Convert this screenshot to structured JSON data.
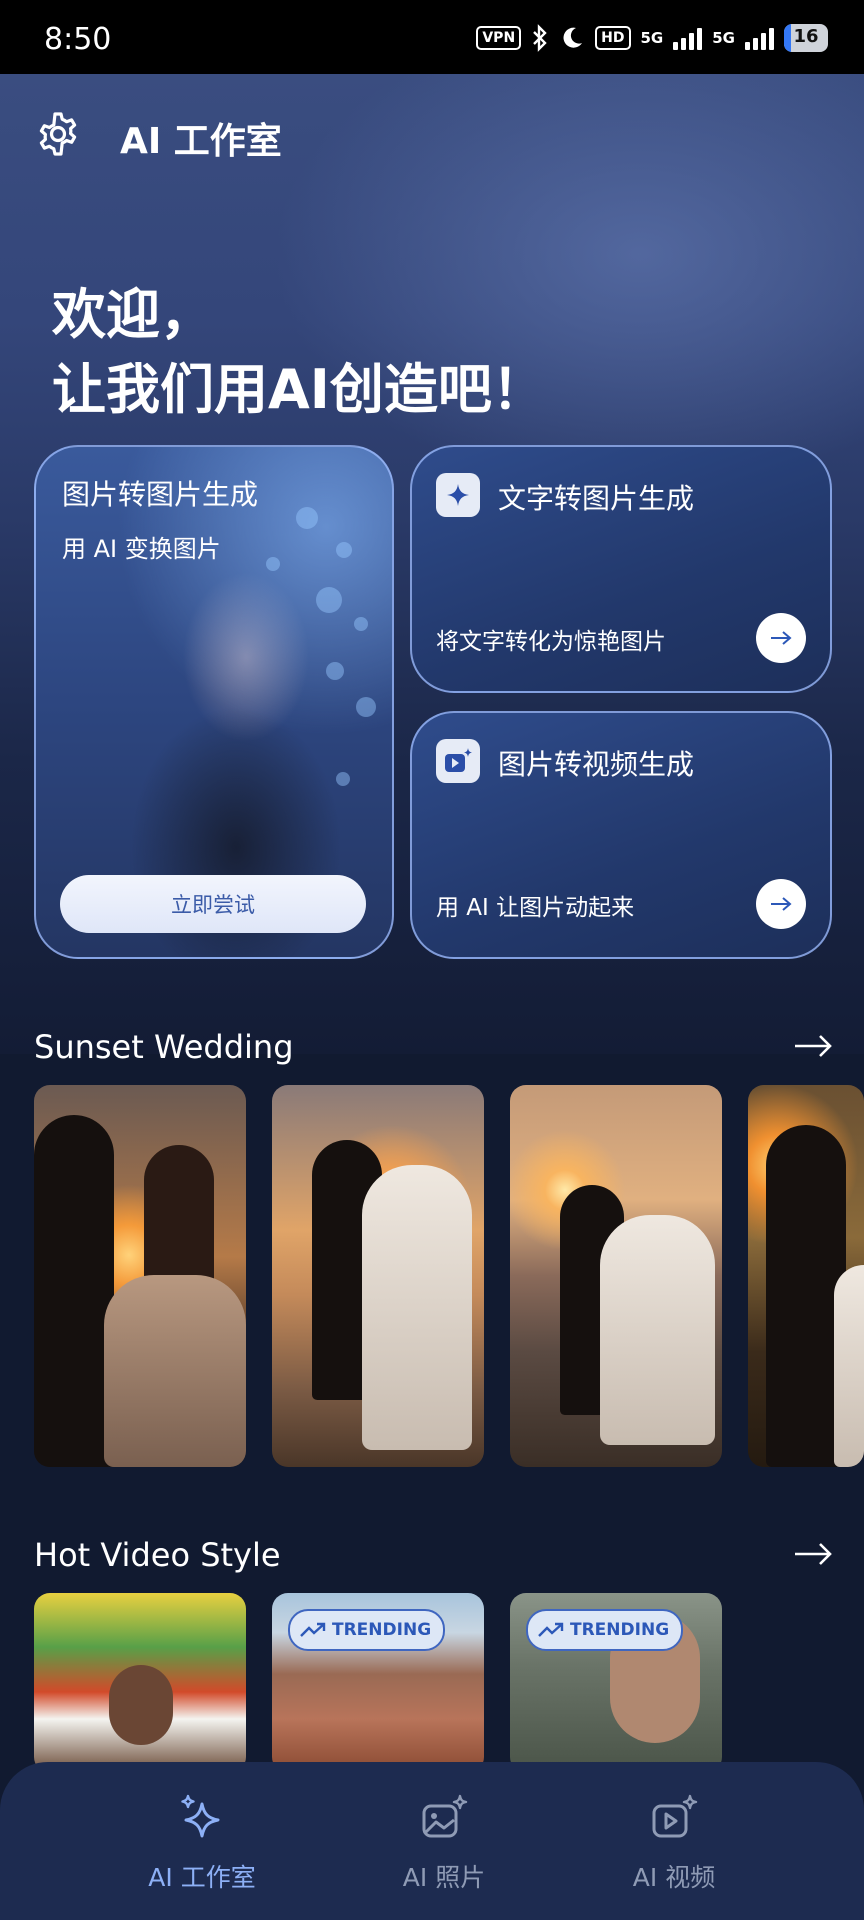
{
  "status_bar": {
    "time": "8:50",
    "vpn": "VPN",
    "hd": "HD",
    "net1": "5G",
    "net2": "5G",
    "battery": "16"
  },
  "header": {
    "title": "AI 工作室",
    "icon": "gear-icon"
  },
  "welcome": {
    "line1": "欢迎，",
    "line2": "让我们用AI创造吧！"
  },
  "cards": {
    "image_to_image": {
      "title": "图片转图片生成",
      "subtitle": "用 AI 变换图片",
      "button": "立即尝试"
    },
    "text_to_image": {
      "title": "文字转图片生成",
      "subtitle": "将文字转化为惊艳图片",
      "icon": "sparkle-chat-icon"
    },
    "image_to_video": {
      "title": "图片转视频生成",
      "subtitle": "用 AI 让图片动起来",
      "icon": "video-sparkle-icon"
    }
  },
  "sections": [
    {
      "title": "Sunset Wedding",
      "items": [
        "wedding-1",
        "wedding-2",
        "wedding-3",
        "wedding-4"
      ]
    },
    {
      "title": "Hot Video Style",
      "items": [
        "video-1",
        "video-2",
        "video-3"
      ],
      "badge": "TRENDING"
    }
  ],
  "bottom_nav": {
    "items": [
      {
        "label": "AI 工作室",
        "icon": "sparkle-icon",
        "active": true
      },
      {
        "label": "AI 照片",
        "icon": "photo-sparkle-icon",
        "active": false
      },
      {
        "label": "AI 视频",
        "icon": "video-sparkle-icon",
        "active": false
      }
    ]
  },
  "colors": {
    "background": "#111a30",
    "card_border": "#a0beff",
    "accent": "#8db0f6",
    "trend_badge": "#2c58b8"
  }
}
